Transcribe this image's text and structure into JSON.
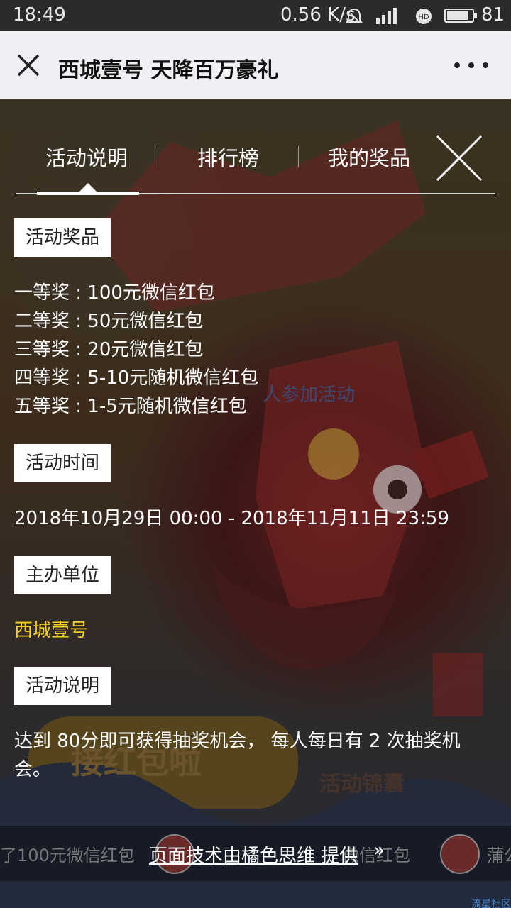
{
  "status_bar": {
    "time": "18:49",
    "speed": "0.56 K/s",
    "battery": "81",
    "battery_level": 0.81
  },
  "title_bar": {
    "title": "西城壹号 天降百万豪礼"
  },
  "tabs": [
    {
      "label": "活动说明",
      "active": true
    },
    {
      "label": "排行榜",
      "active": false
    },
    {
      "label": "我的奖品",
      "active": false
    }
  ],
  "sections": {
    "prizes": {
      "heading": "活动奖品",
      "items": [
        "一等奖 : 100元微信红包",
        "二等奖 : 50元微信红包",
        "三等奖 : 20元微信红包",
        "四等奖 : 5-10元随机微信红包",
        "五等奖 : 1-5元随机微信红包"
      ]
    },
    "time": {
      "heading": "活动时间",
      "value": "2018年10月29日 00:00 - 2018年11月11日 23:59"
    },
    "organizer": {
      "heading": "主办单位",
      "value": "西城壹号"
    },
    "description": {
      "heading": "活动说明",
      "line1": "达到 80分即可获得抽奖机会， 每人每日有 2 次抽奖机",
      "line2": "会。"
    }
  },
  "background": {
    "participants": "人参加活动",
    "button": "接红包啦",
    "tips": "活动锦囊"
  },
  "footer": {
    "ghost_left": "了100元微信红包",
    "ghost_mid": "微信红包",
    "ghost_right": "蒲公",
    "credit": "页面技术由橘色思维 提供",
    "arrow": "»",
    "watermark": "流星社区"
  },
  "colors": {
    "accent_yellow": "#f5d020",
    "title_bar_bg": "#efeff4"
  }
}
